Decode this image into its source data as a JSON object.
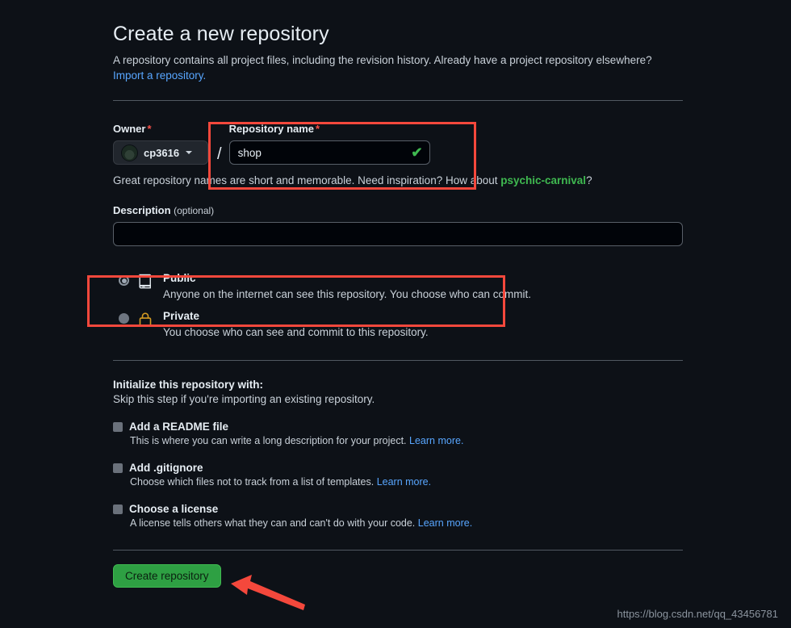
{
  "header": {
    "title": "Create a new repository",
    "intro": "A repository contains all project files, including the revision history. Already have a project repository elsewhere?",
    "import_link": "Import a repository."
  },
  "owner": {
    "label": "Owner",
    "required_mark": "*",
    "name": "cp3616",
    "avatar_icon": "user-avatar",
    "caret_icon": "chevron-down-icon",
    "separator": "/"
  },
  "repo_name": {
    "label": "Repository name",
    "required_mark": "*",
    "value": "shop",
    "placeholder": "",
    "valid_icon": "check-icon"
  },
  "suggestion": {
    "prefix": "Great repository names are short and memorable. Need inspiration? How about ",
    "name": "psychic-carnival",
    "suffix": "?"
  },
  "description": {
    "label": "Description",
    "optional_label": "(optional)",
    "value": "",
    "placeholder": ""
  },
  "visibility": {
    "options": [
      {
        "id": "public",
        "title": "Public",
        "subtitle": "Anyone on the internet can see this repository. You choose who can commit.",
        "icon": "repo-book-icon",
        "selected": true
      },
      {
        "id": "private",
        "title": "Private",
        "subtitle": "You choose who can see and commit to this repository.",
        "icon": "lock-icon",
        "selected": false
      }
    ]
  },
  "initialize": {
    "title": "Initialize this repository with:",
    "subtitle": "Skip this step if you're importing an existing repository.",
    "checkboxes": [
      {
        "id": "readme",
        "label": "Add a README file",
        "description": "This is where you can write a long description for your project.",
        "learn_more": "Learn more.",
        "checked": false
      },
      {
        "id": "gitignore",
        "label": "Add .gitignore",
        "description": "Choose which files not to track from a list of templates.",
        "learn_more": "Learn more.",
        "checked": false
      },
      {
        "id": "license",
        "label": "Choose a license",
        "description": "A license tells others what they can and can't do with your code.",
        "learn_more": "Learn more.",
        "checked": false
      }
    ]
  },
  "footer": {
    "create_button": "Create repository"
  },
  "watermark": {
    "text": "https://blog.csdn.net/qq_43456781"
  },
  "annotations": {
    "highlight_color": "#f4483c",
    "boxes": [
      "repository-name-field",
      "public-visibility-option"
    ],
    "arrow": "points-to-create-repository-button"
  },
  "colors": {
    "background": "#0d1117",
    "accent_green": "#2ea043",
    "link_blue": "#58a6ff",
    "required_red": "#f85149",
    "lock_gold": "#d29922",
    "annotation_red": "#f4483c"
  }
}
